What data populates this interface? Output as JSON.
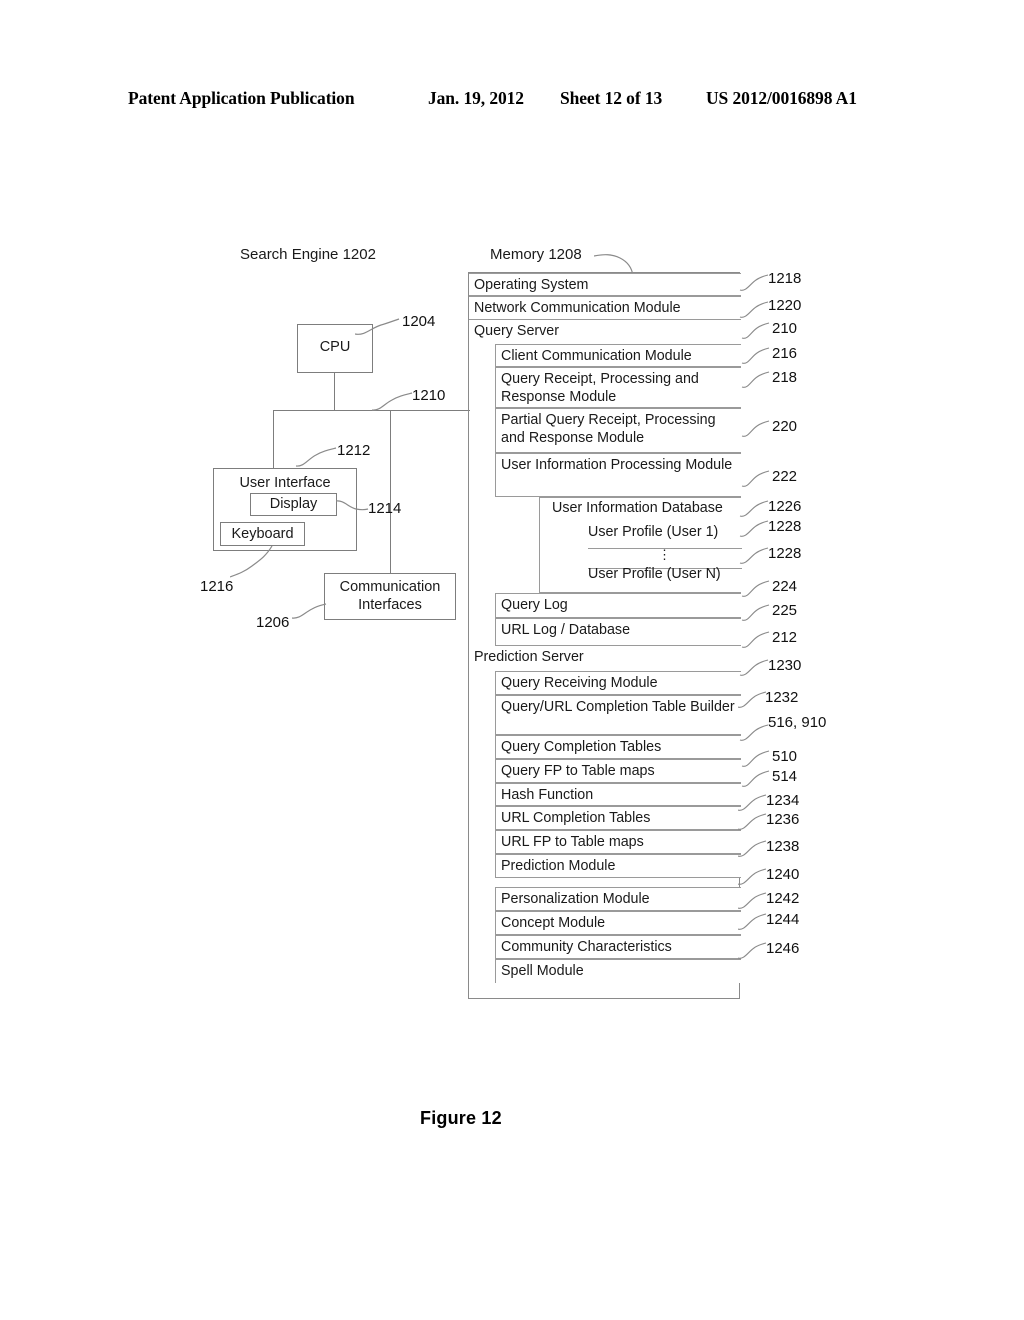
{
  "header": {
    "publication": "Patent Application Publication",
    "date": "Jan. 19, 2012",
    "sheet": "Sheet 12 of 13",
    "patent_number": "US 2012/0016898 A1"
  },
  "figure_caption": "Figure 12",
  "diagram": {
    "title": "Search Engine 1202",
    "memory_title": "Memory 1208",
    "hardware": {
      "cpu": {
        "label": "CPU",
        "ref": "1204"
      },
      "bus": {
        "ref": "1210"
      },
      "user_interface": {
        "label": "User Interface",
        "ref": "1212"
      },
      "display": {
        "label": "Display",
        "ref": "1214"
      },
      "keyboard": {
        "label": "Keyboard",
        "ref": "1216"
      },
      "communication_interfaces": {
        "label": "Communication Interfaces",
        "line1": "Communication",
        "line2": "Interfaces",
        "ref": "1206"
      }
    },
    "memory_rows": [
      {
        "label": "Operating System",
        "ref": "1218",
        "level": 1
      },
      {
        "label": "Network Communication Module",
        "ref": "1220",
        "level": 1
      },
      {
        "label": "Query Server",
        "ref": "210",
        "level": 1
      },
      {
        "label": "Client Communication Module",
        "ref": "216",
        "level": 2
      },
      {
        "label": "Query Receipt, Processing and Response Module",
        "ref": "218",
        "level": 2
      },
      {
        "label": "Partial Query Receipt, Processing and Response Module",
        "ref": "220",
        "level": 2
      },
      {
        "label": "User Information Processing Module",
        "ref": "222",
        "level": 2
      },
      {
        "label": "User Information Database",
        "ref": "1226",
        "level": 3
      },
      {
        "label": "User Profile (User 1)",
        "ref": "1228",
        "level": 4
      },
      {
        "label": "⋮",
        "ref": "",
        "level": 4
      },
      {
        "label": "User Profile (User N)",
        "ref": "1228",
        "level": 4
      },
      {
        "label": "Query Log",
        "ref": "224",
        "level": 2
      },
      {
        "label": "URL Log / Database",
        "ref": "225",
        "level": 2
      },
      {
        "label": "Prediction Server",
        "ref": "212",
        "level": 1
      },
      {
        "label": "Query Receiving Module",
        "ref": "1230",
        "level": 2
      },
      {
        "label": "Query/URL Completion Table Builder",
        "ref": "1232",
        "level": 2
      },
      {
        "label": "Query Completion Tables",
        "ref": "516, 910",
        "level": 2
      },
      {
        "label": "Query FP to Table maps",
        "ref": "510",
        "level": 2
      },
      {
        "label": "Hash Function",
        "ref": "514",
        "level": 2
      },
      {
        "label": "URL Completion Tables",
        "ref": "1234",
        "level": 2
      },
      {
        "label": "URL FP to Table maps",
        "ref": "1236",
        "level": 2
      },
      {
        "label": "Prediction Module",
        "ref": "1238",
        "level": 2
      },
      {
        "label": "Personalization Module",
        "ref": "1240",
        "level": 2
      },
      {
        "label": "Concept Module",
        "ref": "1242",
        "level": 2
      },
      {
        "label": "Community Characteristics",
        "ref": "1244",
        "level": 2
      },
      {
        "label": "Spell Module",
        "ref": "1246",
        "level": 2
      }
    ]
  }
}
